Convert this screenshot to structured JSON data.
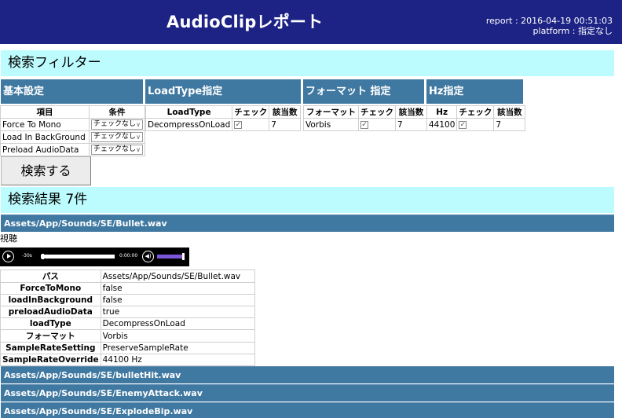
{
  "header": {
    "title": "AudioClipレポート",
    "report_line": "report : 2016-04-19 00:51:03",
    "platform_line": "platform : 指定なし"
  },
  "filter": {
    "section_title": "検索フィルター",
    "basic": {
      "title": "基本設定",
      "col_item": "項目",
      "col_condition": "条件",
      "rows": [
        {
          "label": "Force To Mono",
          "value": "チェックなし"
        },
        {
          "label": "Load In BackGround",
          "value": "チェックなし"
        },
        {
          "label": "Preload AudioData",
          "value": "チェックなし"
        }
      ]
    },
    "loadtype": {
      "title": "LoadType指定",
      "col_a": "LoadType",
      "col_b": "チェック",
      "col_c": "該当数",
      "rows": [
        {
          "name": "DecompressOnLoad",
          "checked": true,
          "count": "7"
        }
      ]
    },
    "format": {
      "title": "フォーマット 指定",
      "col_a": "フォーマット",
      "col_b": "チェック",
      "col_c": "該当数",
      "rows": [
        {
          "name": "Vorbis",
          "checked": true,
          "count": "7"
        }
      ]
    },
    "hz": {
      "title": "Hz指定",
      "col_a": "Hz",
      "col_b": "チェック",
      "col_c": "該当数",
      "rows": [
        {
          "name": "44100",
          "checked": true,
          "count": "7"
        }
      ]
    },
    "search_label": "検索する"
  },
  "results": {
    "section_title": "検索結果 7件",
    "files": [
      "Assets/App/Sounds/SE/Bullet.wav",
      "Assets/App/Sounds/SE/bulletHit.wav",
      "Assets/App/Sounds/SE/EnemyAttack.wav",
      "Assets/App/Sounds/SE/ExplodeBip.wav"
    ],
    "listen_label": "視聴",
    "player": {
      "skip_label": "-30s",
      "time": "0:00:00",
      "progress": 0.0,
      "volume": 1.0
    },
    "details": [
      {
        "key": "パス",
        "value": "Assets/App/Sounds/SE/Bullet.wav"
      },
      {
        "key": "ForceToMono",
        "value": "false"
      },
      {
        "key": "loadInBackground",
        "value": "false"
      },
      {
        "key": "preloadAudioData",
        "value": "true"
      },
      {
        "key": "loadType",
        "value": "DecompressOnLoad"
      },
      {
        "key": "フォーマット",
        "value": "Vorbis"
      },
      {
        "key": "SampleRateSetting",
        "value": "PreserveSampleRate"
      },
      {
        "key": "SampleRateOverride",
        "value": "44100 Hz"
      }
    ]
  },
  "colors": {
    "header_bg": "#1d2385",
    "section_bg": "#bdfcfe",
    "panel_bg": "#3f78a0",
    "volume": "#7c56d7"
  }
}
